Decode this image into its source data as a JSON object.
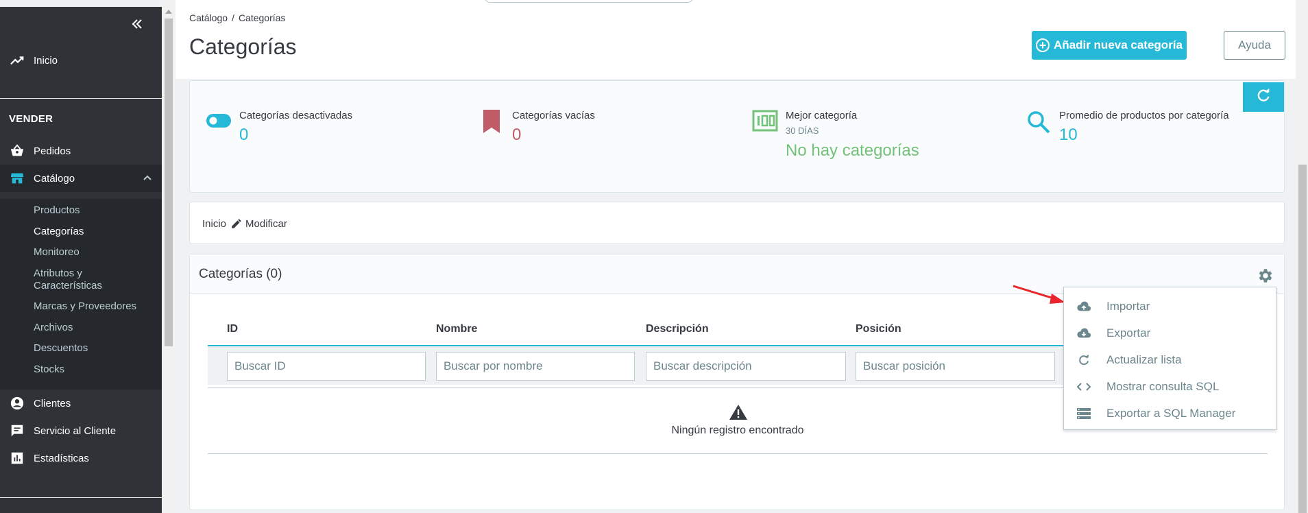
{
  "sidebar": {
    "top_items": [
      {
        "label": "Inicio",
        "icon": "trending-up-icon"
      }
    ],
    "section_label": "VENDER",
    "items": [
      {
        "label": "Pedidos",
        "icon": "basket-icon"
      },
      {
        "label": "Catálogo",
        "icon": "store-icon"
      },
      {
        "label": "Clientes",
        "icon": "account-icon"
      },
      {
        "label": "Servicio al Cliente",
        "icon": "chat-icon"
      },
      {
        "label": "Estadísticas",
        "icon": "bar-chart-icon"
      }
    ],
    "catalog_sub": [
      "Productos",
      "Categorías",
      "Monitoreo",
      "Atributos y Características",
      "Marcas y Proveedores",
      "Archivos",
      "Descuentos",
      "Stocks"
    ],
    "catalog_sub_current": "Categorías",
    "accent": "#25b9d7"
  },
  "header": {
    "breadcrumb": [
      "Catálogo",
      "Categorías"
    ],
    "title": "Categorías",
    "add_button": "Añadir nueva categoría",
    "help_button": "Ayuda"
  },
  "kpis": [
    {
      "title": "Categorías desactivadas",
      "value": "0",
      "color": "#25b9d7",
      "icon": "toggle-icon"
    },
    {
      "title": "Categorías vacías",
      "value": "0",
      "color": "#c05c67",
      "icon": "bookmark-icon"
    },
    {
      "title": "Mejor categoría",
      "subtitle": "30 DÍAS",
      "value": "No hay categorías",
      "color": "#72c279",
      "icon": "counter-icon"
    },
    {
      "title": "Promedio de productos por categoría",
      "value": "10",
      "color": "#25b9d7",
      "icon": "search-icon"
    }
  ],
  "crumb_card": {
    "home": "Inicio",
    "edit": "Modificar"
  },
  "table": {
    "title": "Categorías (0)",
    "columns": [
      "ID",
      "Nombre",
      "Descripción",
      "Posición"
    ],
    "filters": [
      "Buscar ID",
      "Buscar por nombre",
      "Buscar descripción",
      "Buscar posición"
    ],
    "empty_text": "Ningún registro encontrado"
  },
  "dropdown": {
    "items": [
      {
        "label": "Importar",
        "icon": "cloud-upload-icon"
      },
      {
        "label": "Exportar",
        "icon": "cloud-download-icon"
      },
      {
        "label": "Actualizar lista",
        "icon": "refresh-icon"
      },
      {
        "label": "Mostrar consulta SQL",
        "icon": "code-icon"
      },
      {
        "label": "Exportar a SQL Manager",
        "icon": "storage-icon"
      }
    ]
  },
  "annotation_color": "#e8262b"
}
